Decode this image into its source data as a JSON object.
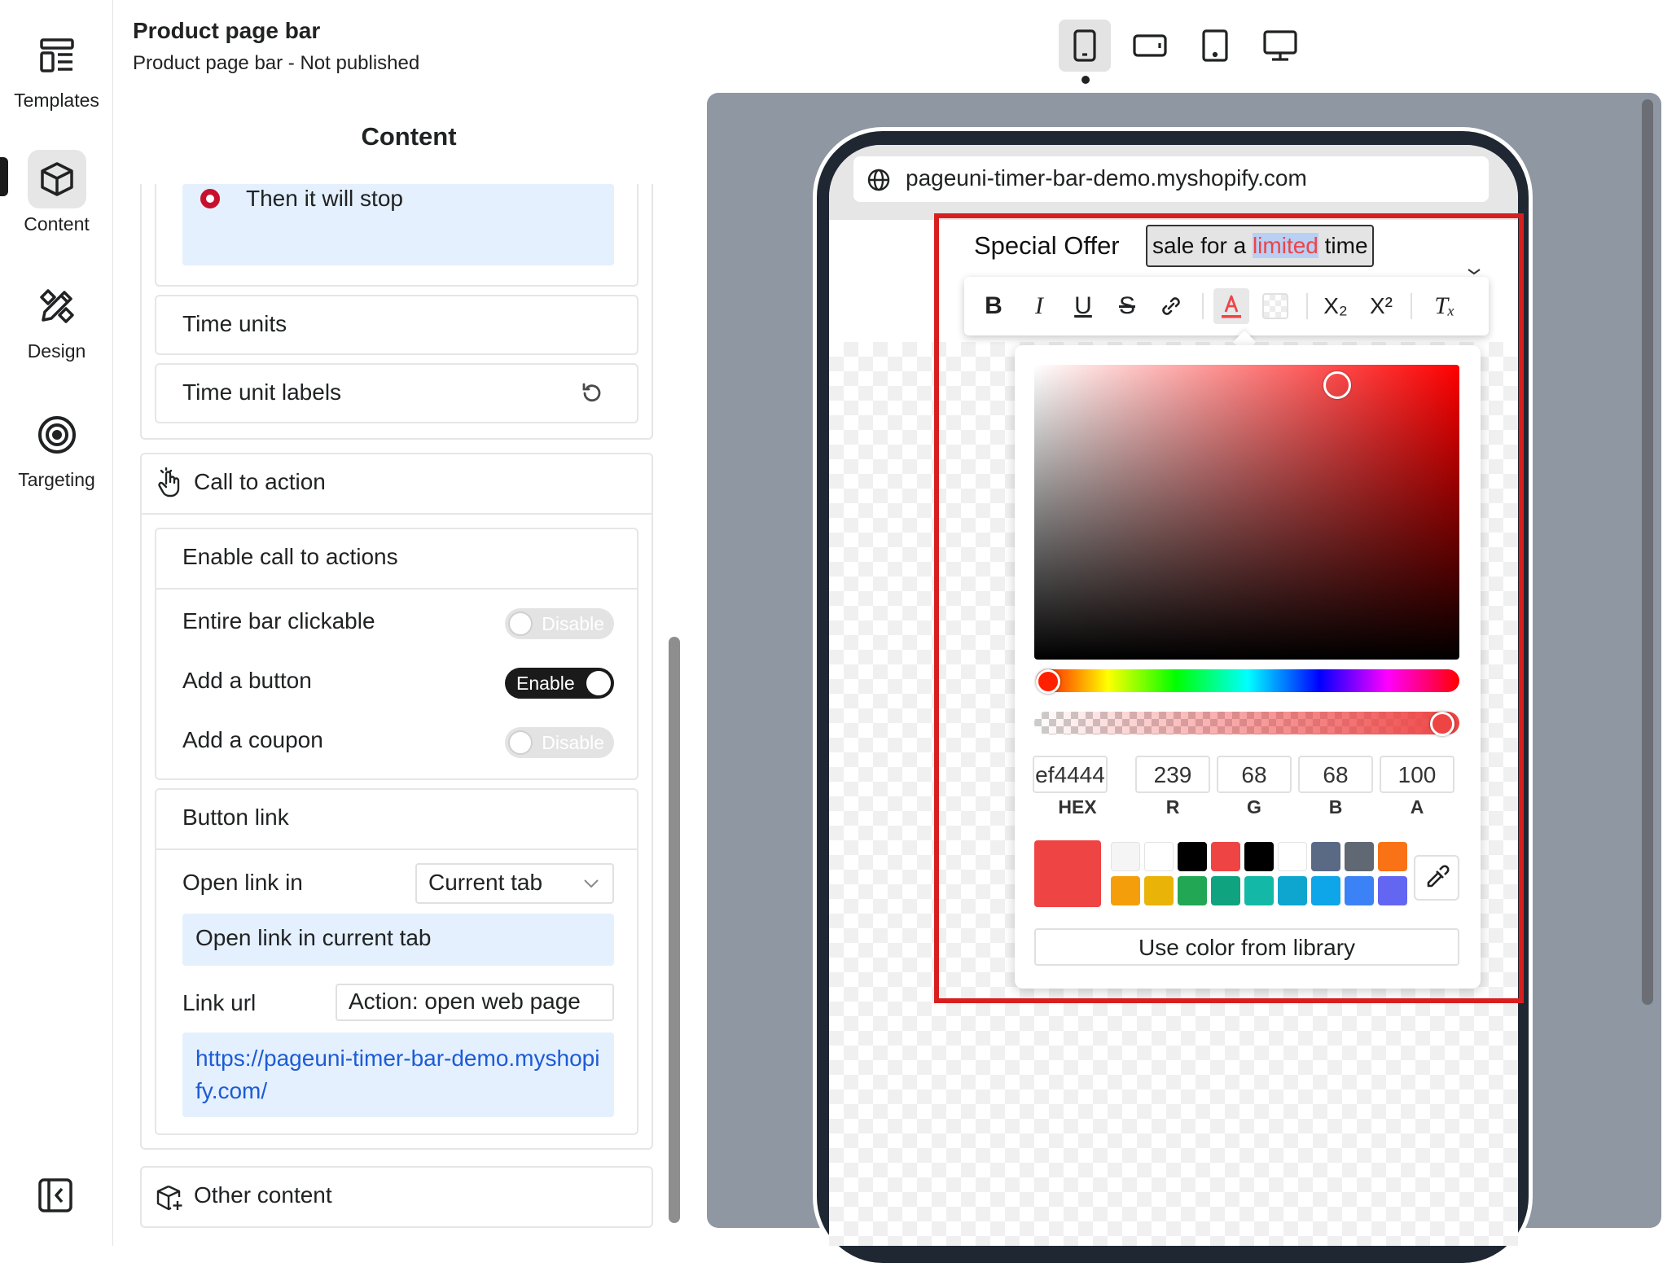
{
  "sidebar": {
    "items": [
      {
        "label": "Templates",
        "icon": "templates-icon"
      },
      {
        "label": "Content",
        "icon": "cube-icon",
        "active": true
      },
      {
        "label": "Design",
        "icon": "design-tools-icon"
      },
      {
        "label": "Targeting",
        "icon": "target-icon"
      }
    ],
    "collapse_icon": "collapse-sidebar-icon"
  },
  "header": {
    "title": "Product page bar",
    "subtitle": "Product page bar  -  Not published"
  },
  "panel": {
    "title": "Content",
    "stop_option": "Then it will stop",
    "time_units": "Time units",
    "time_unit_labels": "Time unit labels",
    "cta": {
      "title": "Call to action",
      "enable_header": "Enable call to actions",
      "rows": [
        {
          "label": "Entire bar clickable",
          "state": "Disable",
          "on": false
        },
        {
          "label": "Add a button",
          "state": "Enable",
          "on": true
        },
        {
          "label": "Add a coupon",
          "state": "Disable",
          "on": false
        }
      ],
      "button_link": {
        "title": "Button link",
        "open_link_label": "Open link in",
        "open_link_value": "Current tab",
        "open_link_hint": "Open link in current tab",
        "link_url_label": "Link url",
        "link_url_action": "Action: open web page",
        "link_url_value": "https://pageuni-timer-bar-demo.myshopify.com/"
      }
    },
    "other_content": "Other content"
  },
  "devices": [
    "mobile",
    "landscape",
    "tablet",
    "desktop"
  ],
  "devices_active": "mobile",
  "preview": {
    "url": "pageuni-timer-bar-demo.myshopify.com",
    "offer_label": "Special Offer",
    "offer_text_before": "sale for a ",
    "offer_text_highlight": "limited",
    "offer_text_after": " time"
  },
  "toolbar": {
    "bold": "B",
    "italic": "I",
    "underline": "U",
    "strike": "S",
    "subscript": "X₂",
    "superscript": "X²",
    "clear_format": "Tₓ",
    "icons": [
      "link-icon",
      "text-color-icon",
      "background-color-icon"
    ]
  },
  "color_picker": {
    "hex": "ef4444",
    "r": "239",
    "g": "68",
    "b": "68",
    "a": "100",
    "labels": {
      "hex": "HEX",
      "r": "R",
      "g": "G",
      "b": "B",
      "a": "A"
    },
    "current_color": "#ef4444",
    "swatches_row1": [
      "#f5f5f5",
      "#ffffff",
      "#000000",
      "#ef4444",
      "#000000",
      "#ffffff",
      "#5a6a85",
      "#5f6873",
      "#f97316"
    ],
    "swatches_row2": [
      "#f59e0b",
      "#eab308",
      "#22a755",
      "#10a37f",
      "#14b8a6",
      "#0ea5cf",
      "#0ea5e9",
      "#3b82f6",
      "#6366f1"
    ],
    "library_button": "Use color from library"
  }
}
